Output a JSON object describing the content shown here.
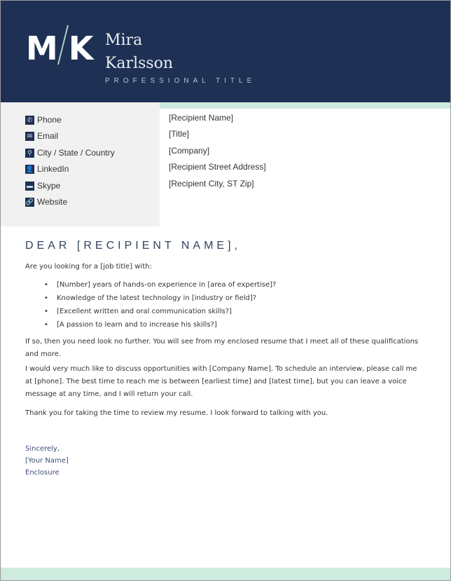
{
  "header": {
    "monogram_left": "M",
    "monogram_right": "K",
    "first_name": "Mira",
    "last_name": "Karlsson",
    "professional_title": "PROFESSIONAL TITLE"
  },
  "contact": [
    {
      "icon": "phone-icon",
      "glyph": "✆",
      "label": "Phone"
    },
    {
      "icon": "email-icon",
      "glyph": "✉",
      "label": "Email"
    },
    {
      "icon": "location-icon",
      "glyph": "⚲",
      "label": "City / State / Country"
    },
    {
      "icon": "linkedin-icon",
      "glyph": "👤",
      "label": "LinkedIn"
    },
    {
      "icon": "skype-icon",
      "glyph": "▬",
      "label": "Skype"
    },
    {
      "icon": "website-icon",
      "glyph": "🔗",
      "label": "Website"
    }
  ],
  "recipient": [
    "[Recipient Name]",
    "[Title]",
    "[Company]",
    "[Recipient Street Address]",
    "[Recipient City, ST Zip]"
  ],
  "salutation": "DEAR [RECIPIENT NAME],",
  "intro": "Are you looking for a [job title] with:",
  "bullets": [
    "[Number] years of hands-on experience in [area of expertise]?",
    "Knowledge of the latest technology in [industry or field]?",
    "[Excellent written and oral communication skills?]",
    "[A passion to learn and to increase his skills?]"
  ],
  "paragraphs": [
    "If so, then you need look no further. You will see from my enclosed resume that I meet all of these qualifications and more.",
    "I would very much like to discuss opportunities with [Company Name]. To schedule an interview, please call me at [phone]. The best time to reach me is between [earliest time] and [latest time], but you can leave a voice message at any time, and I will return your call.",
    "Thank you for taking the time to review my resume. I look forward to talking with you."
  ],
  "closing": {
    "sign_off": "Sincerely,",
    "name": "[Your Name]",
    "enclosure": "Enclosure"
  },
  "colors": {
    "navy": "#1e3054",
    "mint": "#cfeade",
    "sidebar_bg": "#f1f1f1"
  }
}
